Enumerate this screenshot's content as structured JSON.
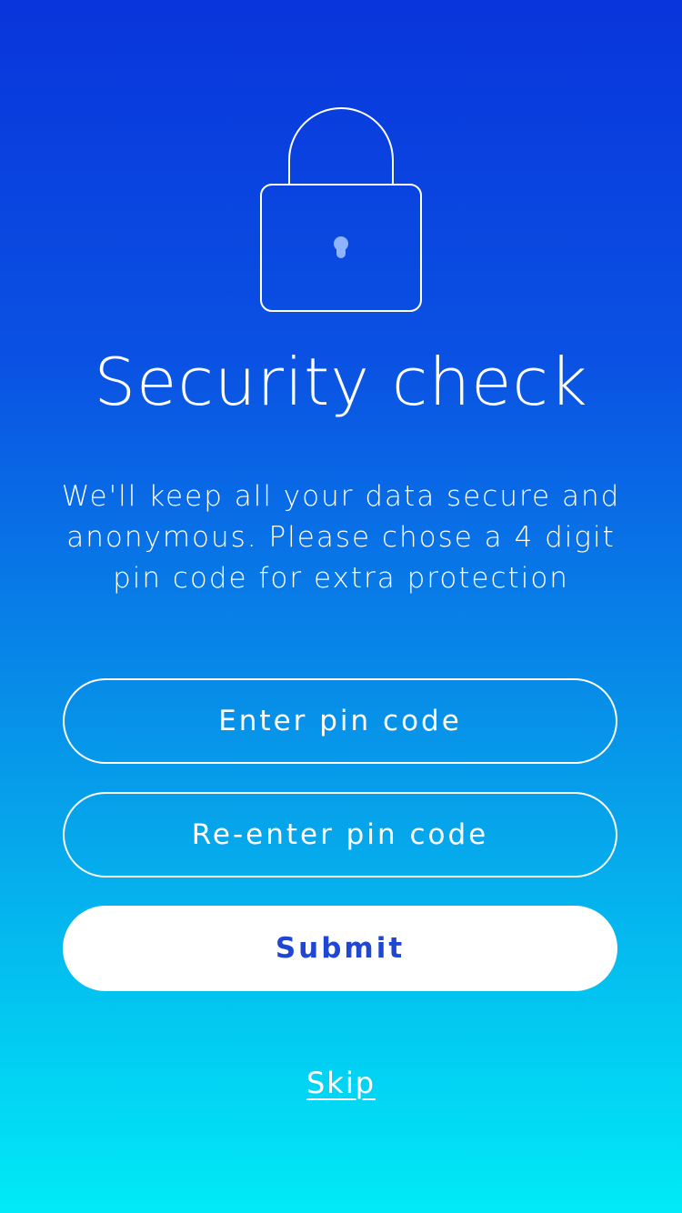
{
  "header": {
    "icon": "lock-icon",
    "title": "Security check"
  },
  "body": {
    "description": "We'll keep all your data secure and anonymous. Please chose a 4 digit pin code for extra protection"
  },
  "form": {
    "pin_label": "Enter pin code",
    "repin_label": "Re-enter pin code",
    "submit_label": "Submit"
  },
  "footer": {
    "skip_label": "Skip"
  },
  "colors": {
    "gradient_top": "#0935dc",
    "gradient_bottom": "#00ebf7",
    "submit_text": "#2046d6",
    "keyhole": "#8fb4ff"
  }
}
